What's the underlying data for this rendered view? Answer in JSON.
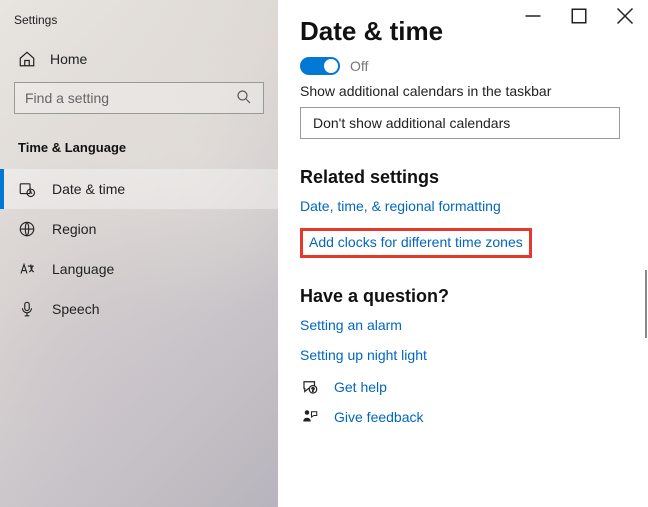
{
  "window": {
    "title": "Settings"
  },
  "controls": {
    "minimize": "—",
    "maximize": "☐",
    "close": "✕"
  },
  "sidebar": {
    "home": "Home",
    "searchPlaceholder": "Find a setting",
    "section": "Time & Language",
    "items": [
      {
        "label": "Date & time"
      },
      {
        "label": "Region"
      },
      {
        "label": "Language"
      },
      {
        "label": "Speech"
      }
    ]
  },
  "main": {
    "title": "Date & time",
    "toggleState": "Off",
    "additionalCalendarsLabel": "Show additional calendars in the taskbar",
    "additionalCalendarsValue": "Don't show additional calendars",
    "relatedHeading": "Related settings",
    "relatedLinks": [
      "Date, time, & regional formatting",
      "Add clocks for different time zones"
    ],
    "questionHeading": "Have a question?",
    "questionLinks": [
      "Setting an alarm",
      "Setting up night light"
    ],
    "getHelp": "Get help",
    "giveFeedback": "Give feedback"
  }
}
